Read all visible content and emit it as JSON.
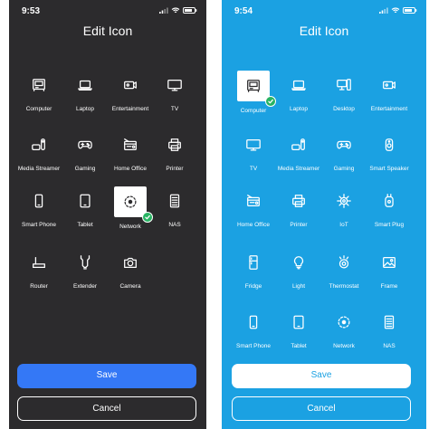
{
  "dark": {
    "time": "9:53",
    "title": "Edit Icon",
    "accent": "#3478f6",
    "items": [
      {
        "label": "Computer",
        "icon": "computer-icon"
      },
      {
        "label": "Laptop",
        "icon": "laptop-icon"
      },
      {
        "label": "Entertainment",
        "icon": "entertainment-icon"
      },
      {
        "label": "TV",
        "icon": "tv-icon"
      },
      {
        "label": "Media Streamer",
        "icon": "media-streamer-icon"
      },
      {
        "label": "Gaming",
        "icon": "gamepad-icon"
      },
      {
        "label": "Home Office",
        "icon": "home-office-icon"
      },
      {
        "label": "Printer",
        "icon": "printer-icon"
      },
      {
        "label": "Smart Phone",
        "icon": "smartphone-icon"
      },
      {
        "label": "Tablet",
        "icon": "tablet-icon"
      },
      {
        "label": "Network",
        "icon": "network-icon",
        "selected": true
      },
      {
        "label": "NAS",
        "icon": "nas-icon"
      },
      {
        "label": "Router",
        "icon": "router-icon"
      },
      {
        "label": "Extender",
        "icon": "extender-icon"
      },
      {
        "label": "Camera",
        "icon": "camera-icon"
      }
    ],
    "save_label": "Save",
    "cancel_label": "Cancel"
  },
  "blue": {
    "time": "9:54",
    "title": "Edit Icon",
    "accent": "#1ba1e2",
    "items": [
      {
        "label": "Computer",
        "icon": "computer-icon",
        "selected": true
      },
      {
        "label": "Laptop",
        "icon": "laptop-icon"
      },
      {
        "label": "Desktop",
        "icon": "desktop-icon"
      },
      {
        "label": "Entertainment",
        "icon": "entertainment-icon"
      },
      {
        "label": "TV",
        "icon": "tv-icon"
      },
      {
        "label": "Media Streamer",
        "icon": "media-streamer-icon"
      },
      {
        "label": "Gaming",
        "icon": "gamepad-icon"
      },
      {
        "label": "Smart Speaker",
        "icon": "smart-speaker-icon"
      },
      {
        "label": "Home Office",
        "icon": "home-office-icon"
      },
      {
        "label": "Printer",
        "icon": "printer-icon"
      },
      {
        "label": "IoT",
        "icon": "iot-icon"
      },
      {
        "label": "Smart Plug",
        "icon": "smart-plug-icon"
      },
      {
        "label": "Fridge",
        "icon": "fridge-icon"
      },
      {
        "label": "Light",
        "icon": "light-icon"
      },
      {
        "label": "Thermostat",
        "icon": "thermostat-icon"
      },
      {
        "label": "Frame",
        "icon": "frame-icon"
      },
      {
        "label": "Smart Phone",
        "icon": "smartphone-icon"
      },
      {
        "label": "Tablet",
        "icon": "tablet-icon"
      },
      {
        "label": "Network",
        "icon": "network-icon"
      },
      {
        "label": "NAS",
        "icon": "nas-icon"
      }
    ],
    "save_label": "Save",
    "cancel_label": "Cancel"
  }
}
